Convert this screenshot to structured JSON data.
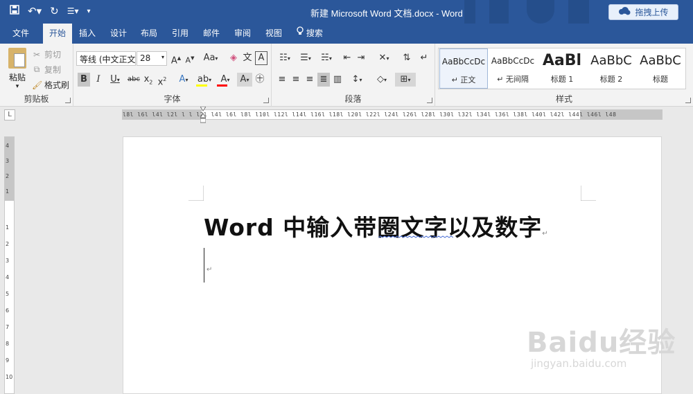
{
  "window": {
    "title": "新建 Microsoft Word 文档.docx - Word",
    "upload_button": "拖拽上传"
  },
  "tabs": [
    {
      "label": "文件"
    },
    {
      "label": "开始",
      "active": true
    },
    {
      "label": "插入"
    },
    {
      "label": "设计"
    },
    {
      "label": "布局"
    },
    {
      "label": "引用"
    },
    {
      "label": "邮件"
    },
    {
      "label": "审阅"
    },
    {
      "label": "视图"
    }
  ],
  "tell_me": "搜索",
  "ribbon": {
    "clipboard": {
      "label": "剪贴板",
      "paste": "粘贴",
      "cut": "剪切",
      "copy": "复制",
      "format_painter": "格式刷"
    },
    "font": {
      "label": "字体",
      "font_name": "等线 (中文正文)",
      "font_size": "28"
    },
    "paragraph": {
      "label": "段落"
    },
    "styles": {
      "label": "样式",
      "items": [
        {
          "sample": "AaBbCcDc",
          "name": "正文"
        },
        {
          "sample": "AaBbCcDc",
          "name": "无间隔"
        },
        {
          "sample": "AaBl",
          "name": "标题 1"
        },
        {
          "sample": "AaBbC",
          "name": "标题 2"
        },
        {
          "sample": "AaBbC",
          "name": "标题"
        }
      ]
    }
  },
  "ruler": {
    "corner": "L",
    "ticks": "l8l l6l l4l l2l l l l2l l4l l6l l8l l10l l12l l14l l16l l18l l20l l22l l24l l26l l28l l30l l32l l34l l36l l38l l40l l42l l44l l46l l48"
  },
  "document": {
    "heading": "Word 中输入带圈文字以及数字",
    "paragraph_mark": "↵"
  },
  "watermark": {
    "brand": "Baidu经验",
    "url": "jingyan.baidu.com"
  },
  "colors": {
    "accent": "#2b579a",
    "highlight": "#ffff00",
    "font_color": "#ff0000"
  }
}
